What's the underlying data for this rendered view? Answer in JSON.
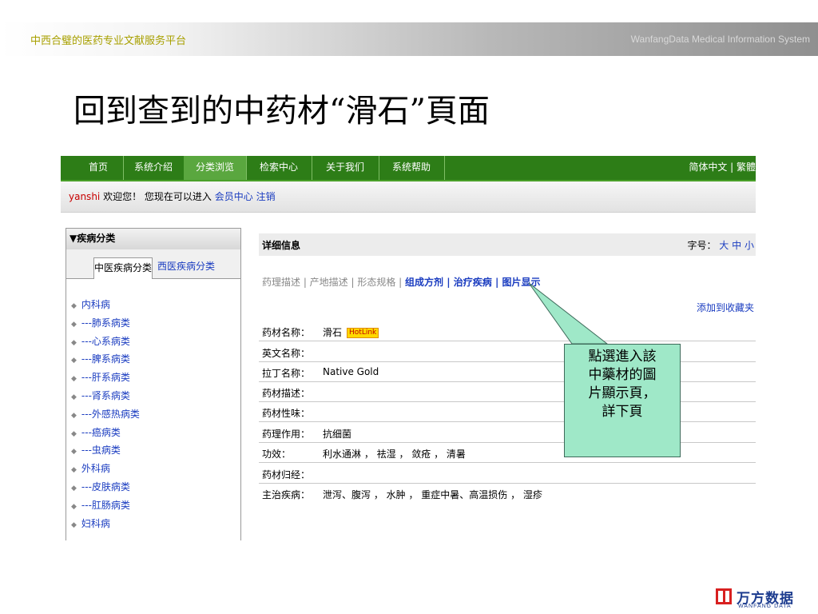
{
  "slide": {
    "header_left": "中西合璧的医药专业文献服务平台",
    "header_right": "WanfangData Medical Information System",
    "title": "回到查到的中药材“滑石”頁面"
  },
  "nav": {
    "items": [
      "首页",
      "系统介绍",
      "分类浏览",
      "检索中心",
      "关于我们",
      "系统帮助"
    ],
    "active_index": 2,
    "lang": "简体中文 | 繁體"
  },
  "welcome": {
    "user": "yanshi",
    "text": "欢迎您！  您现在可以进入",
    "member_link": "会员中心",
    "logout_link": "注销"
  },
  "sidebar": {
    "title": "▼疾病分类",
    "tab_active": "中医疾病分类",
    "tab_other": "西医疾病分类",
    "items": [
      "内科病",
      "---肺系病类",
      "---心系病类",
      "---脾系病类",
      "---肝系病类",
      "---肾系病类",
      "---外感热病类",
      "---癌病类",
      "---虫病类",
      "外科病",
      "---皮肤病类",
      "---肛肠病类",
      "妇科病"
    ]
  },
  "detail": {
    "title": "详细信息",
    "font_label": "字号：",
    "font_sizes": [
      "大",
      "中",
      "小"
    ],
    "links_gray": "药理描述 | 产地描述 | 形态规格 | ",
    "links_bold": "组成方剂 | 治疗疾病 | 图片显示",
    "favorite": "添加到收藏夹",
    "hotlink": "HotLink",
    "rows": [
      {
        "k": "药材名称：",
        "v": "滑石"
      },
      {
        "k": "英文名称：",
        "v": ""
      },
      {
        "k": "拉丁名称：",
        "v": "Native Gold"
      },
      {
        "k": "药材描述：",
        "v": ""
      },
      {
        "k": "药材性味：",
        "v": ""
      },
      {
        "k": "药理作用：",
        "v": "抗细菌"
      },
      {
        "k": "功效：",
        "v": "利水通淋 ， 祛湿 ， 敛疮 ， 清暑"
      },
      {
        "k": "药材归经：",
        "v": ""
      },
      {
        "k": "主治疾病：",
        "v": "泄泻、腹泻 ， 水肿 ， 重症中暑、高温损伤 ， 湿疹"
      }
    ]
  },
  "callout": {
    "lines": [
      "點選進入該",
      "中藥材的圖",
      "片顯示頁，",
      "詳下頁"
    ]
  },
  "logo": {
    "cn": "万方数据",
    "en": "WANFANG DATA"
  }
}
